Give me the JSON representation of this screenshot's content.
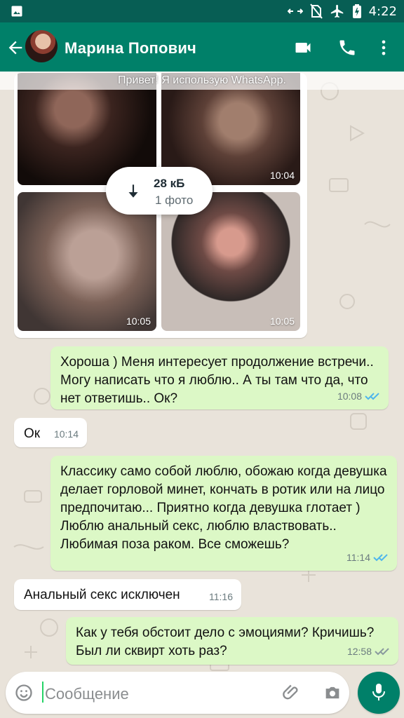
{
  "status_bar": {
    "time": "4:22",
    "icons": [
      "gallery-icon",
      "data-sync-icon",
      "no-sim-icon",
      "airplane-mode-icon",
      "battery-charging-icon"
    ]
  },
  "header": {
    "contact_name": "Марина Попович",
    "icons": [
      "back-arrow-icon",
      "avatar",
      "video-call-icon",
      "phone-call-icon",
      "overflow-menu-icon"
    ]
  },
  "chat": {
    "intro_banner": "Привет! Я использую WhatsApp.",
    "media": {
      "download_size": "28 кБ",
      "download_count": "1 фото",
      "thumb_times": [
        "10:04",
        "10:05",
        "10:05"
      ]
    },
    "messages": [
      {
        "text": "Хороша ) Меня интересует продолжение встречи.. Могу написать что я люблю.. А ты там что да, что нет ответишь.. Ок?",
        "time": "10:08",
        "outgoing": true,
        "read": true
      },
      {
        "text": "Ок",
        "time": "10:14",
        "outgoing": false
      },
      {
        "text": "Классику само собой люблю, обожаю когда девушка делает горловой минет, кончать в ротик или на лицо предпочитаю... Приятно когда девушка глотает ) Люблю анальный секс, люблю властвовать.. Любимая поза раком. Все сможешь?",
        "time": "11:14",
        "outgoing": true,
        "read": true
      },
      {
        "text": "Анальный секс исключен",
        "time": "11:16",
        "outgoing": false
      },
      {
        "text": "Как у тебя обстоит дело с эмоциями? Кричишь? Был ли сквирт хоть раз?",
        "time": "12:58",
        "outgoing": true,
        "read": false
      }
    ]
  },
  "composer": {
    "placeholder": "Сообщение"
  },
  "colors": {
    "header": "#008069",
    "statusbar": "#075e54",
    "outgoing": "#dcf8c6",
    "incoming": "#ffffff",
    "tick_read": "#4fb6ec",
    "tick_unread": "#8a9a9e"
  }
}
